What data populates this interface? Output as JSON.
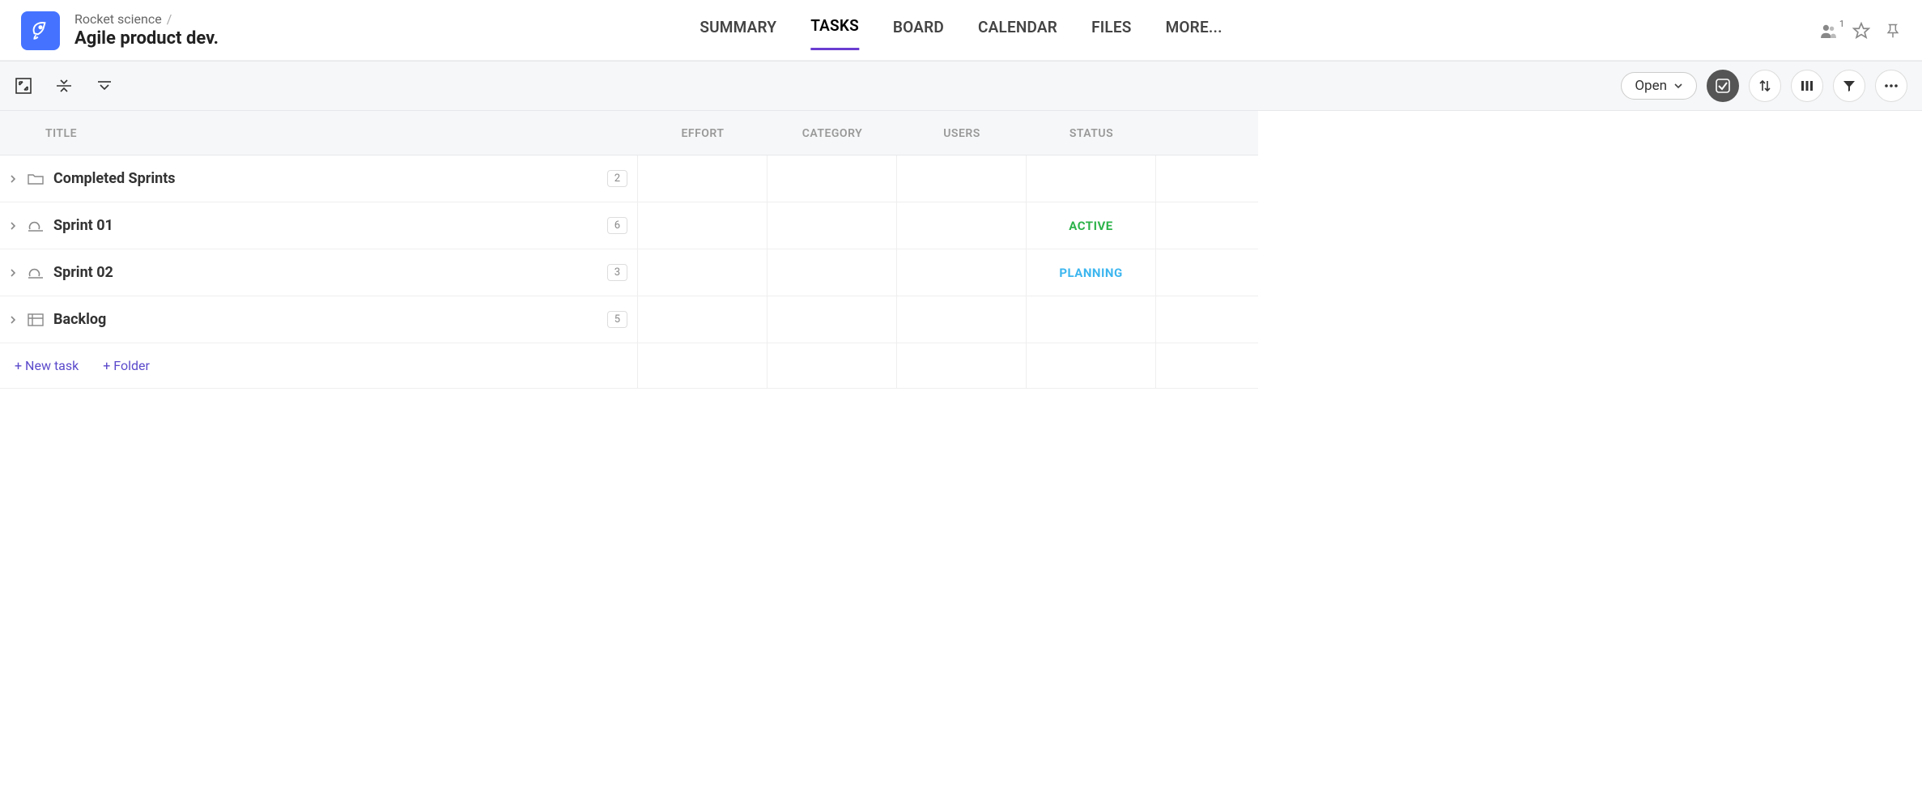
{
  "header": {
    "breadcrumb": {
      "parent": "Rocket science",
      "separator": "/"
    },
    "page_title": "Agile product dev.",
    "collaborator_count": "1",
    "tabs": [
      {
        "label": "SUMMARY"
      },
      {
        "label": "TASKS",
        "active": true
      },
      {
        "label": "BOARD"
      },
      {
        "label": "CALENDAR"
      },
      {
        "label": "FILES"
      },
      {
        "label": "MORE..."
      }
    ]
  },
  "toolbar": {
    "filter_label": "Open"
  },
  "columns": {
    "title": "TITLE",
    "effort": "EFFORT",
    "category": "CATEGORY",
    "users": "USERS",
    "status": "STATUS"
  },
  "rows": [
    {
      "icon": "folder",
      "label": "Completed Sprints",
      "count": "2",
      "status": ""
    },
    {
      "icon": "sprint",
      "label": "Sprint 01",
      "count": "6",
      "status": "ACTIVE"
    },
    {
      "icon": "sprint",
      "label": "Sprint 02",
      "count": "3",
      "status": "PLANNING"
    },
    {
      "icon": "list",
      "label": "Backlog",
      "count": "5",
      "status": ""
    }
  ],
  "footer": {
    "new_task": "+ New task",
    "new_folder": "+ Folder"
  }
}
